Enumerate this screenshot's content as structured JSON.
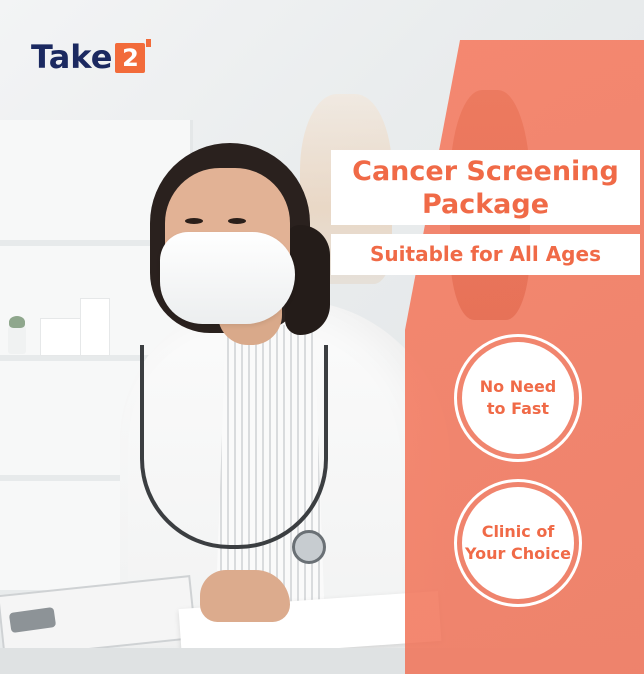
{
  "brand": {
    "logo_text": "Take",
    "logo_badge": "2"
  },
  "headline": {
    "title_line1": "Cancer Screening",
    "title_line2": "Package",
    "subtitle": "Suitable for All Ages"
  },
  "features": [
    {
      "label": "No Need\nto Fast"
    },
    {
      "label": "Clinic of\nYour Choice"
    }
  ],
  "colors": {
    "accent": "#f06a47",
    "brand_navy": "#1b2960",
    "badge_orange": "#f26b3a",
    "panel_orange": "#f7785c"
  }
}
